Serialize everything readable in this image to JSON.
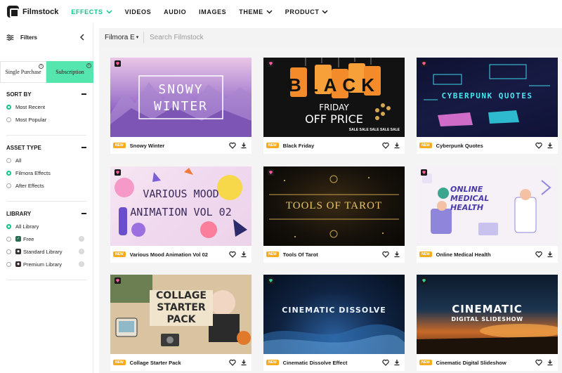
{
  "nav": {
    "logo": "Filmstock",
    "items": [
      {
        "label": "EFFECTS",
        "active": true,
        "has_dropdown": true
      },
      {
        "label": "VIDEOS",
        "active": false,
        "has_dropdown": false
      },
      {
        "label": "AUDIO",
        "active": false,
        "has_dropdown": false
      },
      {
        "label": "IMAGES",
        "active": false,
        "has_dropdown": false
      },
      {
        "label": "THEME",
        "active": false,
        "has_dropdown": true
      },
      {
        "label": "PRODUCT",
        "active": false,
        "has_dropdown": true
      }
    ],
    "accent_color": "#13c28a"
  },
  "sidebar": {
    "filters_label": "Filters",
    "purchase": {
      "single": "Single Purchase",
      "subscription": "Subscription"
    },
    "sort_by": {
      "title": "SORT BY",
      "options": [
        {
          "label": "Most Recent",
          "selected": true
        },
        {
          "label": "Most Popular",
          "selected": false
        }
      ]
    },
    "asset_type": {
      "title": "ASSET TYPE",
      "options": [
        {
          "label": "All",
          "selected": false
        },
        {
          "label": "Filmora Effects",
          "selected": true
        },
        {
          "label": "After Effects",
          "selected": false
        }
      ]
    },
    "library": {
      "title": "LIBRARY",
      "options": [
        {
          "label": "All Library",
          "selected": true
        },
        {
          "label": "Free",
          "selected": false
        },
        {
          "label": "Standard Library",
          "selected": false
        },
        {
          "label": "Premium Library",
          "selected": false
        }
      ]
    }
  },
  "search": {
    "scope": "Filmora E",
    "placeholder": "Search Filmstock"
  },
  "cards": [
    {
      "title": "Snowy Winter",
      "badge": "NEW",
      "thumb_text": [
        "SNOWY",
        "WINTER"
      ]
    },
    {
      "title": "Black Friday",
      "badge": "NEW",
      "thumb_text": [
        "BLACK",
        "FRIDAY",
        "OFF PRICE",
        "SALE SALE SALE SALE SALE"
      ]
    },
    {
      "title": "Cyberpunk Quotes",
      "badge": "NEW",
      "thumb_text": [
        "CYBERPUNK QUOTES"
      ]
    },
    {
      "title": "Various Mood Animation Vol 02",
      "badge": "NEW",
      "thumb_text": [
        "VARIOUS MOOD",
        "ANIMATION VOL 02"
      ]
    },
    {
      "title": "Tools Of Tarot",
      "badge": "NEW",
      "thumb_text": [
        "TOOLS OF TAROT"
      ]
    },
    {
      "title": "Online Medical Health",
      "badge": "NEW",
      "thumb_text": [
        "ONLINE",
        "MEDICAL",
        "HEALTH"
      ]
    },
    {
      "title": "Collage Starter Pack",
      "badge": "NEW",
      "thumb_text": [
        "COLLAGE",
        "STARTER",
        "PACK"
      ]
    },
    {
      "title": "Cinematic Dissolve Effect",
      "badge": "NEW",
      "thumb_text": [
        "CINEMATIC DISSOLVE"
      ]
    },
    {
      "title": "Cinematic Digital Slideshow",
      "badge": "NEW",
      "thumb_text": [
        "CINEMATIC",
        "DIGITAL SLIDESHOW"
      ]
    }
  ]
}
